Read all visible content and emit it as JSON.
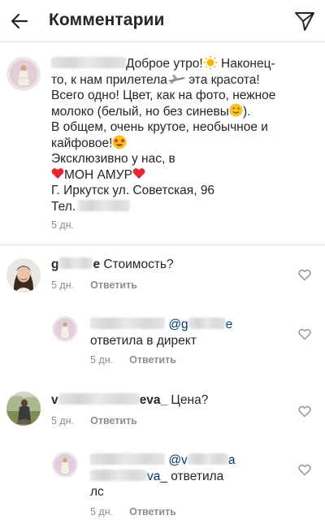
{
  "header": {
    "title": "Комментарии",
    "back_icon": "arrow-left-icon",
    "send_icon": "paper-plane-icon"
  },
  "caption": {
    "text_line1": "Доброе утро!",
    "text_line1b": " Наконец-",
    "text_line2": "то, к нам прилетела",
    "text_line2b": " эта красота!",
    "text_line3": "Всего одно! Цвет, как на фото, нежное",
    "text_line4": "молоко (белый, но без синевы",
    "text_line4b": ").",
    "text_line5": "В общем, очень крутое, необычное и",
    "text_line6": "кайфовое!",
    "text_line7": "Эксклюзивно у нас, в",
    "text_line8": "МОН АМУР",
    "text_line9": "Г. Иркутск ул. Советская, 96",
    "text_line10": "Тел.",
    "time": "5 дн."
  },
  "comments": [
    {
      "username_prefix": "g",
      "username_suffix": "e",
      "text": "Стоимость?",
      "time": "5 дн.",
      "reply_label": "Ответить"
    },
    {
      "mention_prefix": "@g",
      "mention_suffix": "e",
      "text": "ответила в директ",
      "time": "5 дн.",
      "reply_label": "Ответить"
    },
    {
      "username_prefix": "v",
      "username_suffix": "eva_",
      "text": "Цена?",
      "time": "5 дн.",
      "reply_label": "Ответить"
    },
    {
      "mention_prefix": "@v",
      "mention_middle": "a",
      "mention_tail": "va_",
      "text_a": " ответила",
      "text_b": "лс",
      "time": "5 дн.",
      "reply_label": "Ответить"
    }
  ],
  "colors": {
    "text": "#262626",
    "meta": "#8e8e8e",
    "divider": "#e2e2e2",
    "heart_red": "#e0282e"
  }
}
